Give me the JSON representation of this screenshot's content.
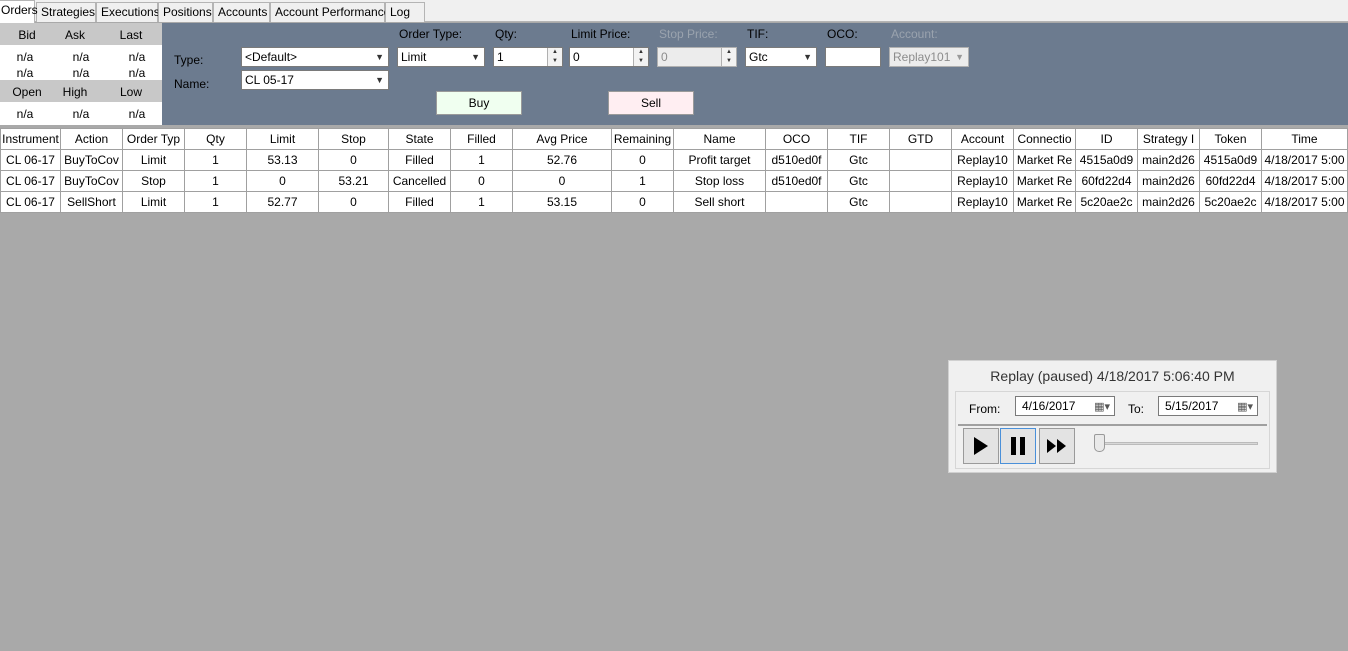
{
  "tabs": [
    {
      "label": "Orders",
      "active": true
    },
    {
      "label": "Strategies"
    },
    {
      "label": "Executions"
    },
    {
      "label": "Positions"
    },
    {
      "label": "Accounts"
    },
    {
      "label": "Account Performance"
    },
    {
      "label": "Log"
    }
  ],
  "quote": {
    "headers1": [
      "Bid",
      "Ask",
      "Last"
    ],
    "row1": [
      "n/a",
      "n/a",
      "n/a"
    ],
    "row2": [
      "n/a",
      "n/a",
      "n/a"
    ],
    "headers2": [
      "Open",
      "High",
      "Low"
    ],
    "row3": [
      "n/a",
      "n/a",
      "n/a"
    ]
  },
  "order_form": {
    "type_label": "Type:",
    "type_value": "<Default>",
    "name_label": "Name:",
    "name_value": "CL 05-17",
    "order_type_label": "Order Type:",
    "order_type_value": "Limit",
    "qty_label": "Qty:",
    "qty_value": "1",
    "limit_price_label": "Limit Price:",
    "limit_price_value": "0",
    "stop_price_label": "Stop Price:",
    "stop_price_value": "0",
    "tif_label": "TIF:",
    "tif_value": "Gtc",
    "oco_label": "OCO:",
    "oco_value": "",
    "account_label": "Account:",
    "account_value": "Replay101",
    "buy_label": "Buy",
    "sell_label": "Sell"
  },
  "orders_table": {
    "columns": [
      "Instrument",
      "Action",
      "Order Typ",
      "Qty",
      "Limit",
      "Stop",
      "State",
      "Filled",
      "Avg Price",
      "Remaining",
      "Name",
      "OCO",
      "TIF",
      "GTD",
      "Account",
      "Connectio",
      "ID",
      "Strategy I",
      "Token",
      "Time"
    ],
    "rows": [
      [
        "CL 06-17",
        "BuyToCov",
        "Limit",
        "1",
        "53.13",
        "0",
        "Filled",
        "1",
        "52.76",
        "0",
        "Profit target",
        "d510ed0f",
        "Gtc",
        "",
        "Replay10",
        "Market Re",
        "4515a0d9",
        "main2d26",
        "4515a0d9",
        "4/18/2017 5:00"
      ],
      [
        "CL 06-17",
        "BuyToCov",
        "Stop",
        "1",
        "0",
        "53.21",
        "Cancelled",
        "0",
        "0",
        "1",
        "Stop loss",
        "d510ed0f",
        "Gtc",
        "",
        "Replay10",
        "Market Re",
        "60fd22d4",
        "main2d26",
        "60fd22d4",
        "4/18/2017 5:00"
      ],
      [
        "CL 06-17",
        "SellShort",
        "Limit",
        "1",
        "52.77",
        "0",
        "Filled",
        "1",
        "53.15",
        "0",
        "Sell short",
        "",
        "Gtc",
        "",
        "Replay10",
        "Market Re",
        "5c20ae2c",
        "main2d26",
        "5c20ae2c",
        "4/18/2017 5:00"
      ]
    ]
  },
  "replay": {
    "title": "Replay (paused) 4/18/2017 5:06:40 PM",
    "from_label": "From:",
    "from_value": "4/16/2017",
    "to_label": "To:",
    "to_value": "5/15/2017",
    "play_icon": "play-icon",
    "pause_icon": "pause-icon",
    "fast_forward_icon": "fast-forward-icon",
    "speed_position": 0.0
  },
  "colors": {
    "order_panel_bg": "#6c7b8f",
    "workspace_bg": "#a9a9a9",
    "buy_bg": "#f0fff0",
    "sell_bg": "#ffeef2"
  }
}
